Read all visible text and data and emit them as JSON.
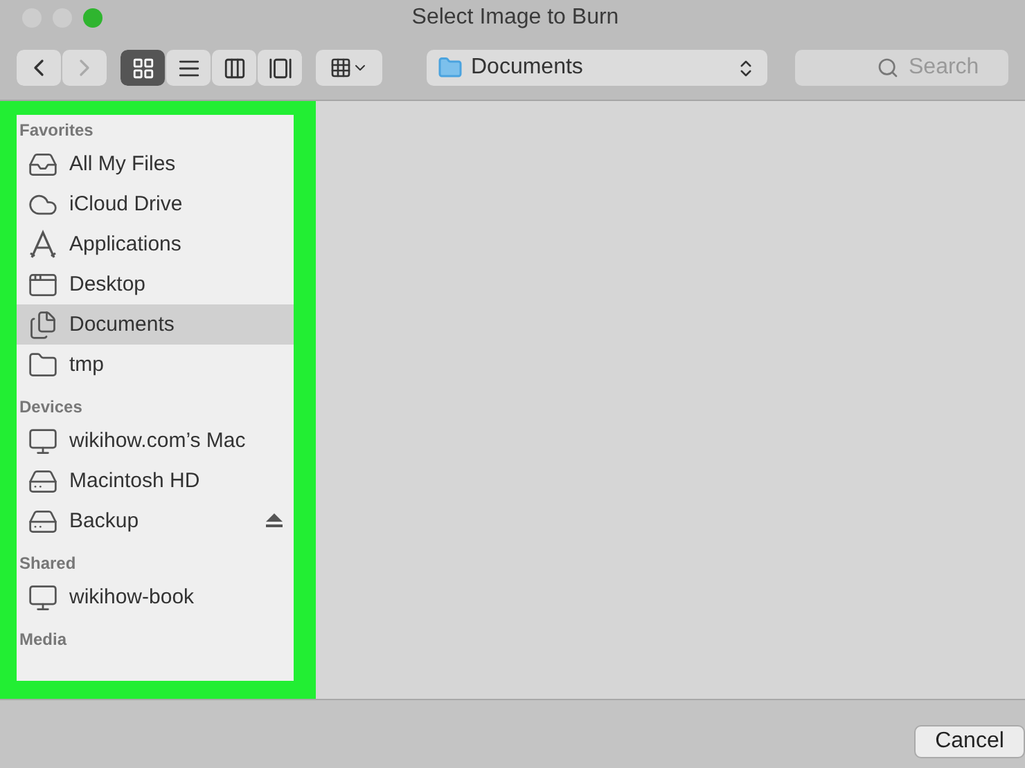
{
  "window": {
    "title": "Select Image to Burn"
  },
  "toolbar": {
    "back_enabled": true,
    "forward_enabled": false,
    "views": [
      {
        "kind": "icons",
        "selected": true
      },
      {
        "kind": "list",
        "selected": false
      },
      {
        "kind": "columns",
        "selected": false
      },
      {
        "kind": "coverflow",
        "selected": false
      }
    ],
    "location": "Documents",
    "search": {
      "placeholder": "Search"
    }
  },
  "sidebar": {
    "highlighted": true,
    "sections": [
      {
        "heading": "Favorites",
        "items": [
          {
            "label": "All My Files",
            "kind": "allfiles",
            "selected": false,
            "ejectable": false
          },
          {
            "label": "iCloud Drive",
            "kind": "cloud",
            "selected": false,
            "ejectable": false
          },
          {
            "label": "Applications",
            "kind": "apps",
            "selected": false,
            "ejectable": false
          },
          {
            "label": "Desktop",
            "kind": "desktop",
            "selected": false,
            "ejectable": false
          },
          {
            "label": "Documents",
            "kind": "documents",
            "selected": true,
            "ejectable": false
          },
          {
            "label": "tmp",
            "kind": "folder",
            "selected": false,
            "ejectable": false
          }
        ]
      },
      {
        "heading": "Devices",
        "items": [
          {
            "label": "wikihow.com’s Mac",
            "kind": "computer",
            "selected": false,
            "ejectable": false
          },
          {
            "label": "Macintosh HD",
            "kind": "disk",
            "selected": false,
            "ejectable": false
          },
          {
            "label": "Backup",
            "kind": "disk",
            "selected": false,
            "ejectable": true
          }
        ]
      },
      {
        "heading": "Shared",
        "items": [
          {
            "label": "wikihow-book",
            "kind": "shared",
            "selected": false,
            "ejectable": false
          }
        ]
      },
      {
        "heading": "Media"
      }
    ]
  },
  "buttons": [
    {
      "label": "Cancel"
    }
  ]
}
